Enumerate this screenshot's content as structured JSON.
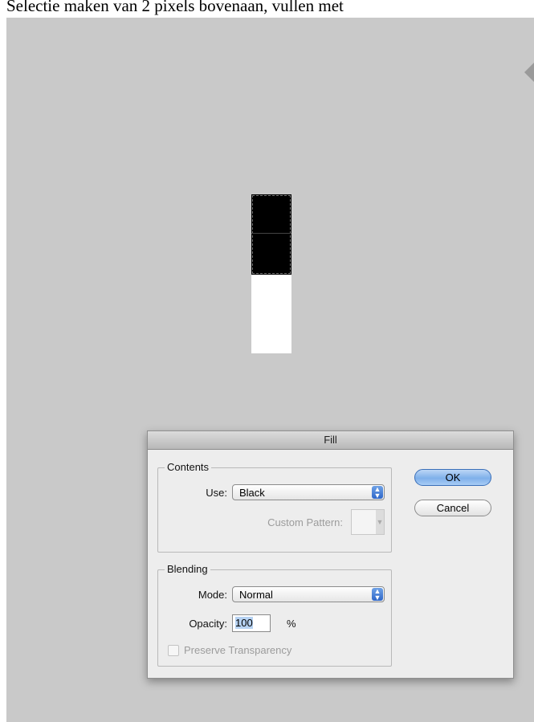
{
  "caption": "Selectie maken van 2 pixels bovenaan, vullen met",
  "dialog": {
    "title": "Fill",
    "contents": {
      "group_title": "Contents",
      "use_label": "Use:",
      "use_value": "Black",
      "custom_pattern_label": "Custom Pattern:"
    },
    "blending": {
      "group_title": "Blending",
      "mode_label": "Mode:",
      "mode_value": "Normal",
      "opacity_label": "Opacity:",
      "opacity_value": "100",
      "opacity_unit": "%",
      "preserve_label": "Preserve Transparency"
    },
    "ok_label": "OK",
    "cancel_label": "Cancel"
  },
  "colors": {
    "canvas_bg": "#c9c9c9",
    "dialog_bg": "#ededed",
    "accent_blue": "#7fb0ea"
  },
  "icons": [
    "updown-arrows-icon",
    "canvas-scroll-arrow-icon"
  ]
}
